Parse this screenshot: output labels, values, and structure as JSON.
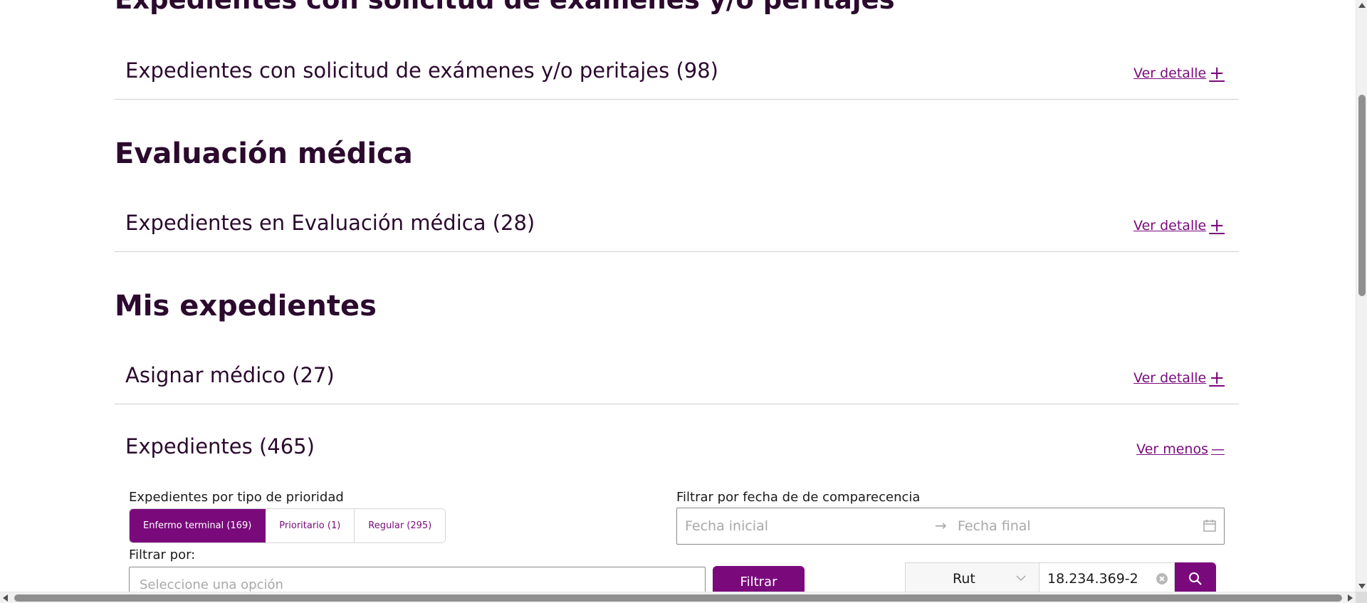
{
  "sections": {
    "examenes_title": "Expedientes con solicitud de exámenes y/o peritajes",
    "evaluacion_title": "Evaluación médica",
    "mis_title": "Mis expedientes"
  },
  "rows": {
    "examenes": {
      "title": "Expedientes con solicitud de exámenes y/o peritajes (98)",
      "link": "Ver detalle",
      "sign": "+"
    },
    "evaluacion": {
      "title": "Expedientes en Evaluación médica (28)",
      "link": "Ver detalle",
      "sign": "+"
    },
    "asignar": {
      "title": "Asignar médico (27)",
      "link": "Ver detalle",
      "sign": "+"
    },
    "expedientes": {
      "title": "Expedientes (465)",
      "link": "Ver menos",
      "sign": "—"
    }
  },
  "filters": {
    "priority_label": "Expedientes por tipo de prioridad",
    "priority_tabs": [
      {
        "label": "Enfermo terminal (169)"
      },
      {
        "label": "Prioritario (1)"
      },
      {
        "label": "Regular (295)"
      }
    ],
    "date_label": "Filtrar por fecha de de comparecencia",
    "date_start_placeholder": "Fecha inicial",
    "date_arrow": "→",
    "date_end_placeholder": "Fecha final",
    "filter_by_label": "Filtrar por:",
    "filter_by_placeholder": "Seleccione una opción",
    "filter_button": "Filtrar",
    "search_type": "Rut",
    "search_value": "18.234.369-2"
  },
  "colors": {
    "primary": "#7a0a7c",
    "heading": "#2b0a2e"
  }
}
